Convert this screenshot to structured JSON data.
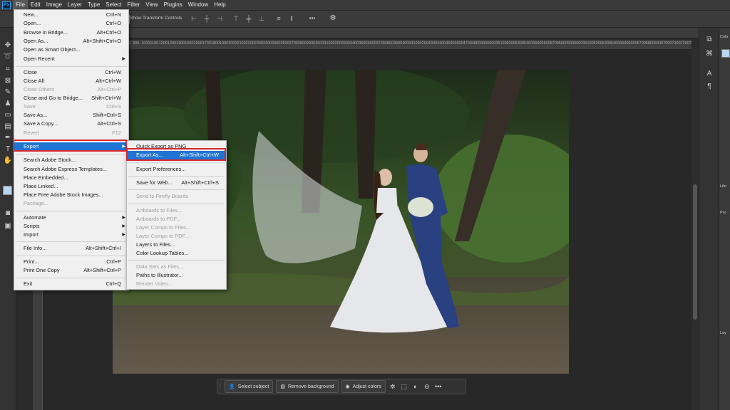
{
  "menubar": {
    "logo": "Ps",
    "items": [
      "File",
      "Edit",
      "Image",
      "Layer",
      "Type",
      "Select",
      "Filter",
      "View",
      "Plugins",
      "Window",
      "Help"
    ]
  },
  "options": {
    "show_transform": "Show Transform Controls",
    "more": "•••"
  },
  "ruler_ticks": [
    "100",
    "0",
    "100",
    "200",
    "300",
    "400",
    "500",
    "600",
    "700",
    "800",
    "900",
    "1000",
    "1100",
    "1200",
    "1300",
    "1400",
    "1500",
    "1600",
    "1700",
    "1800",
    "1900",
    "2000",
    "2100",
    "2200",
    "2300",
    "2400",
    "2500",
    "2600",
    "2700",
    "2800",
    "2900",
    "3000",
    "3100",
    "3200",
    "3300",
    "3400",
    "3500",
    "3600",
    "3700",
    "3800",
    "3900",
    "4000",
    "4100",
    "4200",
    "4300",
    "4400",
    "4500",
    "4600",
    "4700",
    "4800",
    "4900",
    "5000",
    "5100",
    "5200",
    "5300",
    "5400",
    "5500",
    "5600",
    "5700",
    "5800",
    "5900",
    "6000",
    "6100",
    "6200",
    "6300",
    "6400",
    "6500",
    "6600",
    "6700",
    "6800",
    "6900",
    "7000",
    "7100",
    "7200",
    "7300",
    "7400"
  ],
  "file_menu": {
    "items": [
      {
        "label": "New...",
        "shortcut": "Ctrl+N"
      },
      {
        "label": "Open...",
        "shortcut": "Ctrl+O"
      },
      {
        "label": "Browse in Bridge...",
        "shortcut": "Alt+Ctrl+O"
      },
      {
        "label": "Open As...",
        "shortcut": "Alt+Shift+Ctrl+O"
      },
      {
        "label": "Open as Smart Object...",
        "shortcut": ""
      },
      {
        "label": "Open Recent",
        "shortcut": ""
      },
      {
        "label": "Close",
        "shortcut": "Ctrl+W"
      },
      {
        "label": "Close All",
        "shortcut": "Alt+Ctrl+W"
      },
      {
        "label": "Close Others",
        "shortcut": "Alt+Ctrl+P"
      },
      {
        "label": "Close and Go to Bridge...",
        "shortcut": "Shift+Ctrl+W"
      },
      {
        "label": "Save",
        "shortcut": "Ctrl+S"
      },
      {
        "label": "Save As...",
        "shortcut": "Shift+Ctrl+S"
      },
      {
        "label": "Save a Copy...",
        "shortcut": "Alt+Ctrl+S"
      },
      {
        "label": "Revert",
        "shortcut": "F12"
      },
      {
        "label": "Export",
        "shortcut": ""
      },
      {
        "label": "Search Adobe Stock...",
        "shortcut": ""
      },
      {
        "label": "Search Adobe Express Templates...",
        "shortcut": ""
      },
      {
        "label": "Place Embedded...",
        "shortcut": ""
      },
      {
        "label": "Place Linked...",
        "shortcut": ""
      },
      {
        "label": "Place Free Adobe Stock Images...",
        "shortcut": ""
      },
      {
        "label": "Package...",
        "shortcut": ""
      },
      {
        "label": "Automate",
        "shortcut": ""
      },
      {
        "label": "Scripts",
        "shortcut": ""
      },
      {
        "label": "Import",
        "shortcut": ""
      },
      {
        "label": "File Info...",
        "shortcut": "Alt+Shift+Ctrl+I"
      },
      {
        "label": "Print...",
        "shortcut": "Ctrl+P"
      },
      {
        "label": "Print One Copy",
        "shortcut": "Alt+Shift+Ctrl+P"
      },
      {
        "label": "Exit",
        "shortcut": "Ctrl+Q"
      }
    ]
  },
  "export_menu": {
    "items": [
      {
        "label": "Quick Export as PNG",
        "shortcut": ""
      },
      {
        "label": "Export As...",
        "shortcut": "Alt+Shift+Ctrl+W"
      },
      {
        "label": "Export Preferences...",
        "shortcut": ""
      },
      {
        "label": "Save for Web...",
        "shortcut": "Alt+Shift+Ctrl+S"
      },
      {
        "label": "Send to Firefly Boards",
        "shortcut": ""
      },
      {
        "label": "Artboards to Files...",
        "shortcut": ""
      },
      {
        "label": "Artboards to PDF...",
        "shortcut": ""
      },
      {
        "label": "Layer Comps to Files...",
        "shortcut": ""
      },
      {
        "label": "Layer Comps to PDF...",
        "shortcut": ""
      },
      {
        "label": "Layers to Files...",
        "shortcut": ""
      },
      {
        "label": "Color Lookup Tables...",
        "shortcut": ""
      },
      {
        "label": "Data Sets as Files...",
        "shortcut": ""
      },
      {
        "label": "Paths to Illustrator...",
        "shortcut": ""
      },
      {
        "label": "Render Video...",
        "shortcut": ""
      }
    ]
  },
  "context_bar": {
    "select_subject": "Select subject",
    "remove_background": "Remove background",
    "adjust_colors": "Adjust colors"
  },
  "right_panel": {
    "color_tab": "Colo",
    "libraries_tab": "Libr",
    "properties_tab": "Pro",
    "layers_tab": "Lay"
  },
  "colors": {
    "highlight": "#1f74d4",
    "callout": "#d9262c"
  }
}
